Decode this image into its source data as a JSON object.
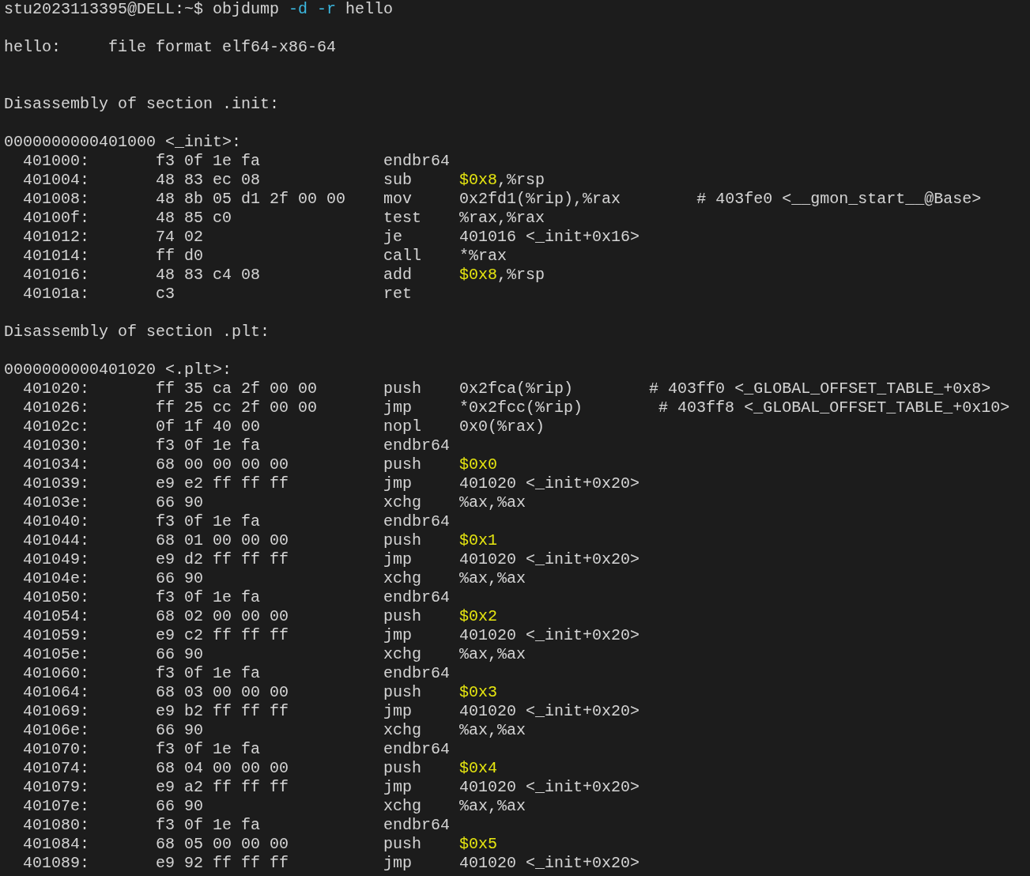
{
  "lines": [
    {
      "kind": "command",
      "prompt": "stu2023113395@DELL:~$",
      "tokens": [
        {
          "text": "objdump",
          "kind": "word"
        },
        {
          "text": "-d",
          "kind": "option"
        },
        {
          "text": "-r",
          "kind": "option"
        },
        {
          "text": "hello",
          "kind": "word"
        }
      ]
    },
    {
      "kind": "blank"
    },
    {
      "kind": "file_format",
      "file": "hello:",
      "format": "file format elf64-x86-64"
    },
    {
      "kind": "blank"
    },
    {
      "kind": "blank"
    },
    {
      "kind": "section",
      "text": "Disassembly of section .init:"
    },
    {
      "kind": "blank"
    },
    {
      "kind": "symbol",
      "text": "0000000000401000 <_init>:"
    },
    {
      "kind": "instruction",
      "address": "401000:",
      "bytes": "f3 0f 1e fa",
      "mnemonic": "endbr64"
    },
    {
      "kind": "instruction",
      "address": "401004:",
      "bytes": "48 83 ec 08",
      "mnemonic": "sub",
      "immediate": "$0x8",
      "operands": ",%rsp"
    },
    {
      "kind": "instruction",
      "address": "401008:",
      "bytes": "48 8b 05 d1 2f 00 00",
      "mnemonic": "mov",
      "operands": "0x2fd1(%rip),%rax",
      "comment": "# 403fe0 <__gmon_start__@Base>"
    },
    {
      "kind": "instruction",
      "address": "40100f:",
      "bytes": "48 85 c0",
      "mnemonic": "test",
      "operands": "%rax,%rax"
    },
    {
      "kind": "instruction",
      "address": "401012:",
      "bytes": "74 02",
      "mnemonic": "je",
      "operands": "401016 <_init+0x16>"
    },
    {
      "kind": "instruction",
      "address": "401014:",
      "bytes": "ff d0",
      "mnemonic": "call",
      "operands": "*%rax"
    },
    {
      "kind": "instruction",
      "address": "401016:",
      "bytes": "48 83 c4 08",
      "mnemonic": "add",
      "immediate": "$0x8",
      "operands": ",%rsp"
    },
    {
      "kind": "instruction",
      "address": "40101a:",
      "bytes": "c3",
      "mnemonic": "ret"
    },
    {
      "kind": "blank"
    },
    {
      "kind": "section",
      "text": "Disassembly of section .plt:"
    },
    {
      "kind": "blank"
    },
    {
      "kind": "symbol",
      "text": "0000000000401020 <.plt>:"
    },
    {
      "kind": "instruction",
      "address": "401020:",
      "bytes": "ff 35 ca 2f 00 00",
      "mnemonic": "push",
      "operands": "0x2fca(%rip)",
      "comment": "# 403ff0 <_GLOBAL_OFFSET_TABLE_+0x8>"
    },
    {
      "kind": "instruction",
      "address": "401026:",
      "bytes": "ff 25 cc 2f 00 00",
      "mnemonic": "jmp",
      "operands": "*0x2fcc(%rip)",
      "comment": "# 403ff8 <_GLOBAL_OFFSET_TABLE_+0x10>"
    },
    {
      "kind": "instruction",
      "address": "40102c:",
      "bytes": "0f 1f 40 00",
      "mnemonic": "nopl",
      "operands": "0x0(%rax)"
    },
    {
      "kind": "instruction",
      "address": "401030:",
      "bytes": "f3 0f 1e fa",
      "mnemonic": "endbr64"
    },
    {
      "kind": "instruction",
      "address": "401034:",
      "bytes": "68 00 00 00 00",
      "mnemonic": "push",
      "immediate": "$0x0"
    },
    {
      "kind": "instruction",
      "address": "401039:",
      "bytes": "e9 e2 ff ff ff",
      "mnemonic": "jmp",
      "operands": "401020 <_init+0x20>"
    },
    {
      "kind": "instruction",
      "address": "40103e:",
      "bytes": "66 90",
      "mnemonic": "xchg",
      "operands": "%ax,%ax"
    },
    {
      "kind": "instruction",
      "address": "401040:",
      "bytes": "f3 0f 1e fa",
      "mnemonic": "endbr64"
    },
    {
      "kind": "instruction",
      "address": "401044:",
      "bytes": "68 01 00 00 00",
      "mnemonic": "push",
      "immediate": "$0x1"
    },
    {
      "kind": "instruction",
      "address": "401049:",
      "bytes": "e9 d2 ff ff ff",
      "mnemonic": "jmp",
      "operands": "401020 <_init+0x20>"
    },
    {
      "kind": "instruction",
      "address": "40104e:",
      "bytes": "66 90",
      "mnemonic": "xchg",
      "operands": "%ax,%ax"
    },
    {
      "kind": "instruction",
      "address": "401050:",
      "bytes": "f3 0f 1e fa",
      "mnemonic": "endbr64"
    },
    {
      "kind": "instruction",
      "address": "401054:",
      "bytes": "68 02 00 00 00",
      "mnemonic": "push",
      "immediate": "$0x2"
    },
    {
      "kind": "instruction",
      "address": "401059:",
      "bytes": "e9 c2 ff ff ff",
      "mnemonic": "jmp",
      "operands": "401020 <_init+0x20>"
    },
    {
      "kind": "instruction",
      "address": "40105e:",
      "bytes": "66 90",
      "mnemonic": "xchg",
      "operands": "%ax,%ax"
    },
    {
      "kind": "instruction",
      "address": "401060:",
      "bytes": "f3 0f 1e fa",
      "mnemonic": "endbr64"
    },
    {
      "kind": "instruction",
      "address": "401064:",
      "bytes": "68 03 00 00 00",
      "mnemonic": "push",
      "immediate": "$0x3"
    },
    {
      "kind": "instruction",
      "address": "401069:",
      "bytes": "e9 b2 ff ff ff",
      "mnemonic": "jmp",
      "operands": "401020 <_init+0x20>"
    },
    {
      "kind": "instruction",
      "address": "40106e:",
      "bytes": "66 90",
      "mnemonic": "xchg",
      "operands": "%ax,%ax"
    },
    {
      "kind": "instruction",
      "address": "401070:",
      "bytes": "f3 0f 1e fa",
      "mnemonic": "endbr64"
    },
    {
      "kind": "instruction",
      "address": "401074:",
      "bytes": "68 04 00 00 00",
      "mnemonic": "push",
      "immediate": "$0x4"
    },
    {
      "kind": "instruction",
      "address": "401079:",
      "bytes": "e9 a2 ff ff ff",
      "mnemonic": "jmp",
      "operands": "401020 <_init+0x20>"
    },
    {
      "kind": "instruction",
      "address": "40107e:",
      "bytes": "66 90",
      "mnemonic": "xchg",
      "operands": "%ax,%ax"
    },
    {
      "kind": "instruction",
      "address": "401080:",
      "bytes": "f3 0f 1e fa",
      "mnemonic": "endbr64"
    },
    {
      "kind": "instruction",
      "address": "401084:",
      "bytes": "68 05 00 00 00",
      "mnemonic": "push",
      "immediate": "$0x5"
    },
    {
      "kind": "instruction",
      "address": "401089:",
      "bytes": "e9 92 ff ff ff",
      "mnemonic": "jmp",
      "operands": "401020 <_init+0x20>"
    }
  ]
}
